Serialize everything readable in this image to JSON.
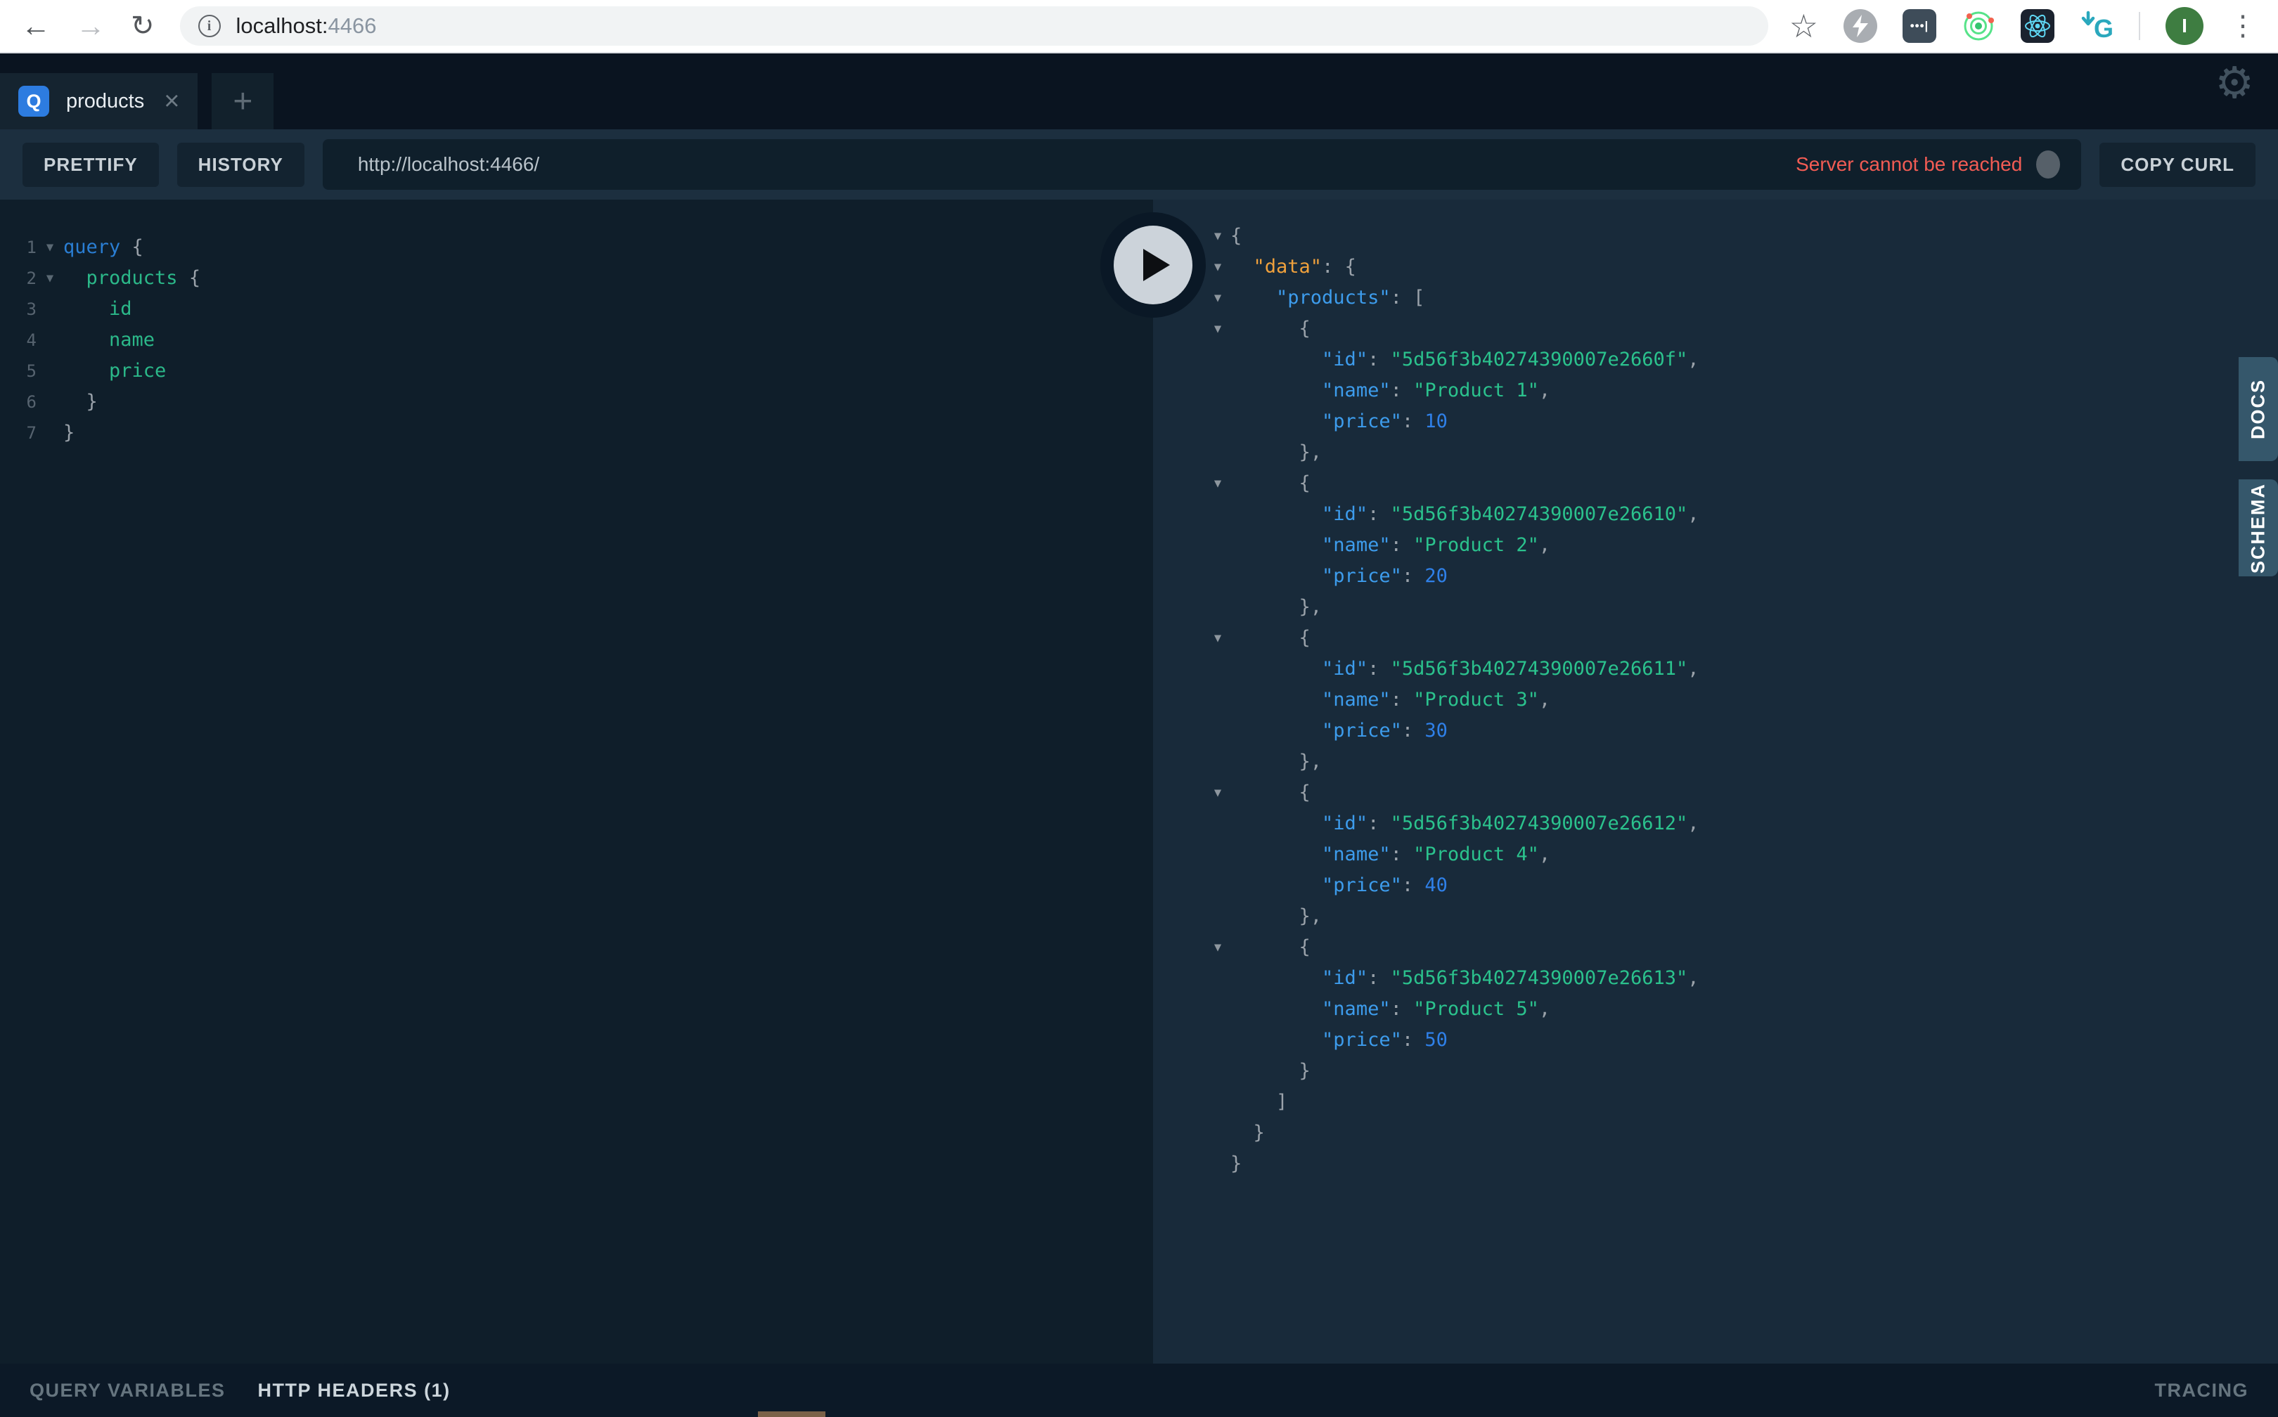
{
  "browser": {
    "url_host": "localhost:",
    "url_port": "4466",
    "profile_initial": "I",
    "info_icon": "i"
  },
  "icons": {
    "back": "←",
    "forward": "→",
    "reload": "↻",
    "star": "☆",
    "menu_dots": "⋮",
    "gear": "⚙",
    "close": "×",
    "plus": "+",
    "fold": "▼",
    "password_dots": "•••|"
  },
  "playground": {
    "tab": {
      "badge": "Q",
      "label": "products"
    },
    "toolbar": {
      "prettify": "PRETTIFY",
      "history": "HISTORY",
      "endpoint": "http://localhost:4466/",
      "server_status": "Server cannot be reached",
      "copy_curl": "COPY CURL"
    },
    "editor": {
      "lines": [
        {
          "n": "1",
          "fold": true,
          "segs": [
            [
              "kw",
              "query"
            ],
            [
              "pn",
              " {"
            ]
          ]
        },
        {
          "n": "2",
          "fold": true,
          "segs": [
            [
              "pl",
              "  "
            ],
            [
              "fd",
              "products"
            ],
            [
              "pn",
              " {"
            ]
          ]
        },
        {
          "n": "3",
          "segs": [
            [
              "pl",
              "    "
            ],
            [
              "fd",
              "id"
            ]
          ]
        },
        {
          "n": "4",
          "segs": [
            [
              "pl",
              "    "
            ],
            [
              "fd",
              "name"
            ]
          ]
        },
        {
          "n": "5",
          "segs": [
            [
              "pl",
              "    "
            ],
            [
              "fd",
              "price"
            ]
          ]
        },
        {
          "n": "6",
          "segs": [
            [
              "pl",
              "  "
            ],
            [
              "pn",
              "}"
            ]
          ]
        },
        {
          "n": "7",
          "segs": [
            [
              "pn",
              "}"
            ]
          ]
        }
      ]
    },
    "response": {
      "lines": [
        {
          "fold": true,
          "segs": [
            [
              "pn",
              "{"
            ]
          ]
        },
        {
          "fold": true,
          "segs": [
            [
              "pl",
              "  "
            ],
            [
              "dk",
              "\"data\""
            ],
            [
              "pn",
              ": {"
            ]
          ]
        },
        {
          "fold": true,
          "segs": [
            [
              "pl",
              "    "
            ],
            [
              "ky",
              "\"products\""
            ],
            [
              "pn",
              ": ["
            ]
          ]
        },
        {
          "fold": true,
          "segs": [
            [
              "pl",
              "      "
            ],
            [
              "pn",
              "{"
            ]
          ]
        },
        {
          "segs": [
            [
              "pl",
              "        "
            ],
            [
              "ky",
              "\"id\""
            ],
            [
              "pn",
              ": "
            ],
            [
              "st",
              "\"5d56f3b40274390007e2660f\""
            ],
            [
              "pn",
              ","
            ]
          ]
        },
        {
          "segs": [
            [
              "pl",
              "        "
            ],
            [
              "ky",
              "\"name\""
            ],
            [
              "pn",
              ": "
            ],
            [
              "st",
              "\"Product 1\""
            ],
            [
              "pn",
              ","
            ]
          ]
        },
        {
          "segs": [
            [
              "pl",
              "        "
            ],
            [
              "ky",
              "\"price\""
            ],
            [
              "pn",
              ": "
            ],
            [
              "nm",
              "10"
            ]
          ]
        },
        {
          "segs": [
            [
              "pl",
              "      "
            ],
            [
              "pn",
              "},"
            ]
          ]
        },
        {
          "fold": true,
          "segs": [
            [
              "pl",
              "      "
            ],
            [
              "pn",
              "{"
            ]
          ]
        },
        {
          "segs": [
            [
              "pl",
              "        "
            ],
            [
              "ky",
              "\"id\""
            ],
            [
              "pn",
              ": "
            ],
            [
              "st",
              "\"5d56f3b40274390007e26610\""
            ],
            [
              "pn",
              ","
            ]
          ]
        },
        {
          "segs": [
            [
              "pl",
              "        "
            ],
            [
              "ky",
              "\"name\""
            ],
            [
              "pn",
              ": "
            ],
            [
              "st",
              "\"Product 2\""
            ],
            [
              "pn",
              ","
            ]
          ]
        },
        {
          "segs": [
            [
              "pl",
              "        "
            ],
            [
              "ky",
              "\"price\""
            ],
            [
              "pn",
              ": "
            ],
            [
              "nm",
              "20"
            ]
          ]
        },
        {
          "segs": [
            [
              "pl",
              "      "
            ],
            [
              "pn",
              "},"
            ]
          ]
        },
        {
          "fold": true,
          "segs": [
            [
              "pl",
              "      "
            ],
            [
              "pn",
              "{"
            ]
          ]
        },
        {
          "segs": [
            [
              "pl",
              "        "
            ],
            [
              "ky",
              "\"id\""
            ],
            [
              "pn",
              ": "
            ],
            [
              "st",
              "\"5d56f3b40274390007e26611\""
            ],
            [
              "pn",
              ","
            ]
          ]
        },
        {
          "segs": [
            [
              "pl",
              "        "
            ],
            [
              "ky",
              "\"name\""
            ],
            [
              "pn",
              ": "
            ],
            [
              "st",
              "\"Product 3\""
            ],
            [
              "pn",
              ","
            ]
          ]
        },
        {
          "segs": [
            [
              "pl",
              "        "
            ],
            [
              "ky",
              "\"price\""
            ],
            [
              "pn",
              ": "
            ],
            [
              "nm",
              "30"
            ]
          ]
        },
        {
          "segs": [
            [
              "pl",
              "      "
            ],
            [
              "pn",
              "},"
            ]
          ]
        },
        {
          "fold": true,
          "segs": [
            [
              "pl",
              "      "
            ],
            [
              "pn",
              "{"
            ]
          ]
        },
        {
          "segs": [
            [
              "pl",
              "        "
            ],
            [
              "ky",
              "\"id\""
            ],
            [
              "pn",
              ": "
            ],
            [
              "st",
              "\"5d56f3b40274390007e26612\""
            ],
            [
              "pn",
              ","
            ]
          ]
        },
        {
          "segs": [
            [
              "pl",
              "        "
            ],
            [
              "ky",
              "\"name\""
            ],
            [
              "pn",
              ": "
            ],
            [
              "st",
              "\"Product 4\""
            ],
            [
              "pn",
              ","
            ]
          ]
        },
        {
          "segs": [
            [
              "pl",
              "        "
            ],
            [
              "ky",
              "\"price\""
            ],
            [
              "pn",
              ": "
            ],
            [
              "nm",
              "40"
            ]
          ]
        },
        {
          "segs": [
            [
              "pl",
              "      "
            ],
            [
              "pn",
              "},"
            ]
          ]
        },
        {
          "fold": true,
          "segs": [
            [
              "pl",
              "      "
            ],
            [
              "pn",
              "{"
            ]
          ]
        },
        {
          "segs": [
            [
              "pl",
              "        "
            ],
            [
              "ky",
              "\"id\""
            ],
            [
              "pn",
              ": "
            ],
            [
              "st",
              "\"5d56f3b40274390007e26613\""
            ],
            [
              "pn",
              ","
            ]
          ]
        },
        {
          "segs": [
            [
              "pl",
              "        "
            ],
            [
              "ky",
              "\"name\""
            ],
            [
              "pn",
              ": "
            ],
            [
              "st",
              "\"Product 5\""
            ],
            [
              "pn",
              ","
            ]
          ]
        },
        {
          "segs": [
            [
              "pl",
              "        "
            ],
            [
              "ky",
              "\"price\""
            ],
            [
              "pn",
              ": "
            ],
            [
              "nm",
              "50"
            ]
          ]
        },
        {
          "segs": [
            [
              "pl",
              "      "
            ],
            [
              "pn",
              "}"
            ]
          ]
        },
        {
          "segs": [
            [
              "pl",
              "    "
            ],
            [
              "pn",
              "]"
            ]
          ]
        },
        {
          "segs": [
            [
              "pl",
              "  "
            ],
            [
              "pn",
              "}"
            ]
          ]
        },
        {
          "segs": [
            [
              "pn",
              "}"
            ]
          ]
        }
      ]
    },
    "side_tabs": [
      "DOCS",
      "SCHEMA"
    ],
    "bottom": {
      "query_variables": "QUERY VARIABLES",
      "http_headers": "HTTP HEADERS (1)",
      "tracing": "TRACING"
    }
  },
  "colors": {
    "status_error": "#f25c54",
    "badge_blue": "#2d7ce0",
    "avatar_green": "#3e7d41",
    "side_tab_bg": "#35576b",
    "tk_kw": "#2a7ed3",
    "tk_fd": "#2bb889",
    "tk_ky": "#3d9cec",
    "tk_dk": "#f0a13c",
    "tk_st": "#2bc28d",
    "tk_nm": "#2f80e8"
  }
}
